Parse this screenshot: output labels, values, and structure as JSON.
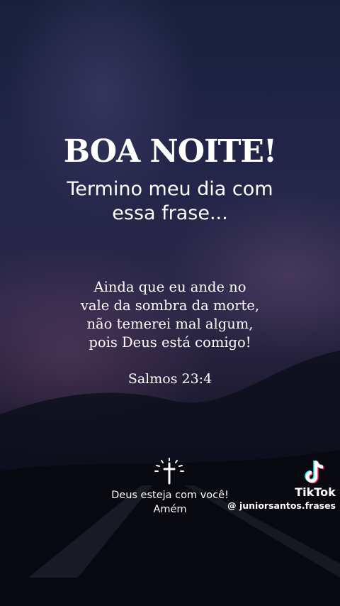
{
  "title": "BOA NOITE!",
  "subtitle": "Termino meu dia com essa frase...",
  "verse": {
    "lines": [
      "Ainda que eu ande no",
      "vale da sombra da morte,",
      "não temerei mal algum,",
      "pois Deus está comigo!"
    ],
    "reference": "Salmos 23:4"
  },
  "blessing": {
    "line1": "Deus esteja com você!",
    "line2": "Amém"
  },
  "watermark": {
    "brand": "TikTok",
    "handle": "@ juniorsantos.frases"
  },
  "icons": {
    "cross": "cross-icon",
    "tiktok": "tiktok-logo-icon"
  }
}
